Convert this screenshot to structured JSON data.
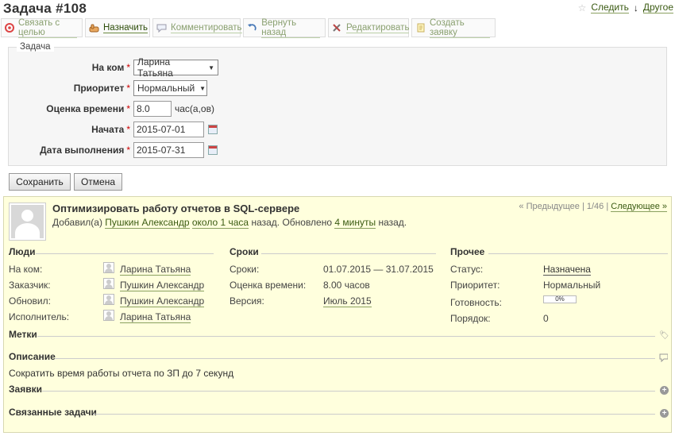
{
  "page": {
    "title": "Задача #108"
  },
  "top_links": {
    "watch": "Следить",
    "other": "Другое"
  },
  "toolbar": [
    {
      "label": "Связать с целью",
      "icon": "target-icon",
      "active": false
    },
    {
      "label": "Назначить",
      "icon": "hand-icon",
      "active": true
    },
    {
      "label": "Комментировать",
      "icon": "comment-icon",
      "active": false
    },
    {
      "label": "Вернуть назад",
      "icon": "undo-icon",
      "active": false
    },
    {
      "label": "Редактировать",
      "icon": "tools-icon",
      "active": false
    },
    {
      "label": "Создать заявку",
      "icon": "document-icon",
      "active": false
    }
  ],
  "form": {
    "legend": "Задача",
    "assignee_label": "На ком",
    "assignee_value": "Ларина Татьяна",
    "priority_label": "Приоритет",
    "priority_value": "Нормальный",
    "estimate_label": "Оценка времени",
    "estimate_value": "8.0",
    "estimate_unit": "час(а,ов)",
    "start_label": "Начата",
    "start_value": "2015-07-01",
    "due_label": "Дата выполнения",
    "due_value": "2015-07-31",
    "required_mark": "*",
    "save": "Сохранить",
    "cancel": "Отмена"
  },
  "issue": {
    "subject": "Оптимизировать работу отчетов в SQL-сервере",
    "added_prefix": "Добавил(а)",
    "author": "Пушкин Александр",
    "added_ago": "около 1 часа",
    "updated_prefix": "назад. Обновлено",
    "updated_ago": "4 минуты",
    "updated_suffix": "назад.",
    "pager_prev": "« Предыдущее",
    "pager_count": "| 1/46 |",
    "pager_next": "Следующее »",
    "people": {
      "title": "Люди",
      "assignee_label": "На ком:",
      "assignee": "Ларина Татьяна",
      "customer_label": "Заказчик:",
      "customer": "Пушкин Александр",
      "updated_by_label": "Обновил:",
      "updated_by": "Пушкин Александр",
      "executor_label": "Исполнитель:",
      "executor": "Ларина Татьяна"
    },
    "dates": {
      "title": "Сроки",
      "range_label": "Сроки:",
      "range": "01.07.2015 — 31.07.2015",
      "estimate_label": "Оценка времени:",
      "estimate": "8.00 часов",
      "version_label": "Версия:",
      "version": "Июль 2015"
    },
    "other": {
      "title": "Прочее",
      "status_label": "Статус:",
      "status": "Назначена",
      "priority_label": "Приоритет:",
      "priority": "Нормальный",
      "done_label": "Готовность:",
      "done": "0%",
      "order_label": "Порядок:",
      "order": "0"
    },
    "tags_title": "Метки",
    "description_title": "Описание",
    "description": "Сократить время работы отчета по ЗП до 7 секунд",
    "requests_title": "Заявки",
    "related_title": "Связанные задачи"
  }
}
